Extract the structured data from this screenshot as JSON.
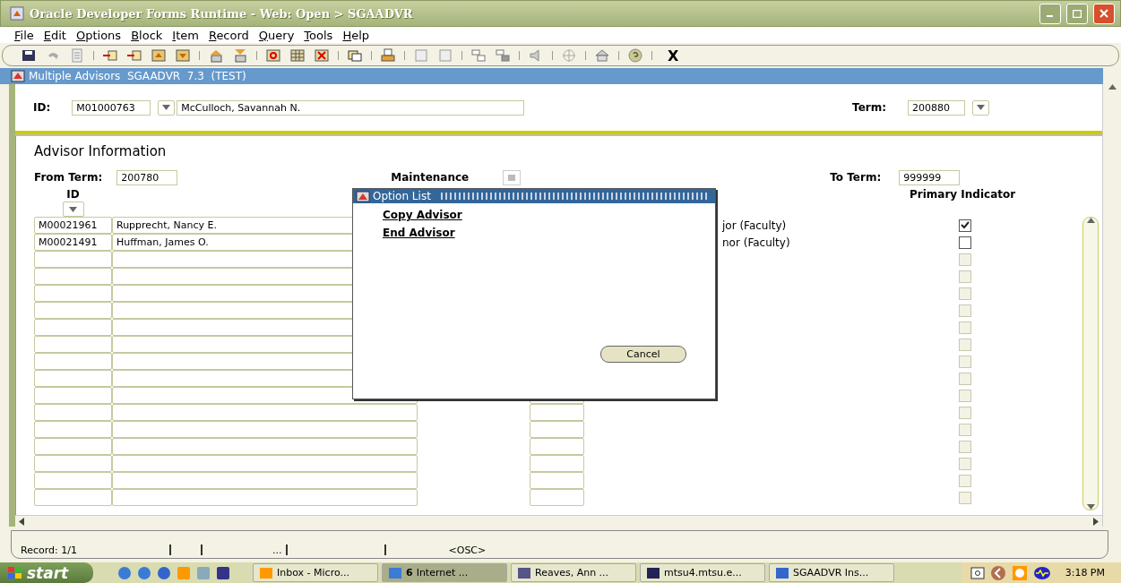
{
  "window": {
    "title": "Oracle Developer Forms Runtime - Web:  Open > SGAADVR"
  },
  "menu": [
    {
      "label": "File"
    },
    {
      "label": "Edit"
    },
    {
      "label": "Options"
    },
    {
      "label": "Block"
    },
    {
      "label": "Item"
    },
    {
      "label": "Record"
    },
    {
      "label": "Query"
    },
    {
      "label": "Tools"
    },
    {
      "label": "Help"
    }
  ],
  "toolbar": {
    "exit_label": "X"
  },
  "form": {
    "title": "Multiple Advisors  SGAADVR  7.3  (TEST)",
    "key_block": {
      "id_label": "ID:",
      "id_value": "M01000763",
      "name_value": "McCulloch, Savannah N.",
      "term_label": "Term:",
      "term_value": "200880"
    },
    "section_title": "Advisor Information",
    "from_term_label": "From Term:",
    "from_term_value": "200780",
    "maintenance_label": "Maintenance",
    "to_term_label": "To Term:",
    "to_term_value": "999999",
    "columns": {
      "id": "ID",
      "primary": "Primary Indicator"
    },
    "rows": [
      {
        "id": "M00021961",
        "name": "Rupprecht, Nancy E.",
        "type": "jor (Faculty)",
        "checked": true,
        "disabled": false
      },
      {
        "id": "M00021491",
        "name": "Huffman, James O.",
        "type": "nor (Faculty)",
        "checked": false,
        "disabled": false
      },
      {
        "checked": false,
        "disabled": true
      },
      {
        "checked": false,
        "disabled": true
      },
      {
        "checked": false,
        "disabled": true
      },
      {
        "checked": false,
        "disabled": true
      },
      {
        "checked": false,
        "disabled": true
      },
      {
        "checked": false,
        "disabled": true
      },
      {
        "checked": false,
        "disabled": true
      },
      {
        "checked": false,
        "disabled": true
      },
      {
        "checked": false,
        "disabled": true
      },
      {
        "checked": false,
        "disabled": true
      },
      {
        "checked": false,
        "disabled": true
      },
      {
        "checked": false,
        "disabled": true
      },
      {
        "checked": false,
        "disabled": true
      },
      {
        "checked": false,
        "disabled": true
      },
      {
        "checked": false,
        "disabled": true
      }
    ]
  },
  "dialog": {
    "title": "Option List",
    "options": [
      "Copy Advisor",
      "End Advisor"
    ],
    "cancel": "Cancel"
  },
  "status_bar": {
    "record": "Record: 1/1",
    "ellipsis": "...",
    "mode": "<OSC>"
  },
  "taskbar": {
    "start": "start",
    "tasks": [
      {
        "label": "Inbox - Micro...",
        "selected": false
      },
      {
        "badge": "6",
        "label": "Internet ...",
        "selected": true
      },
      {
        "label": "Reaves, Ann ...",
        "selected": false
      },
      {
        "label": "mtsu4.mtsu.e...",
        "selected": false
      },
      {
        "label": "SGAADVR Ins...",
        "selected": false
      }
    ],
    "clock": "3:18 PM"
  }
}
